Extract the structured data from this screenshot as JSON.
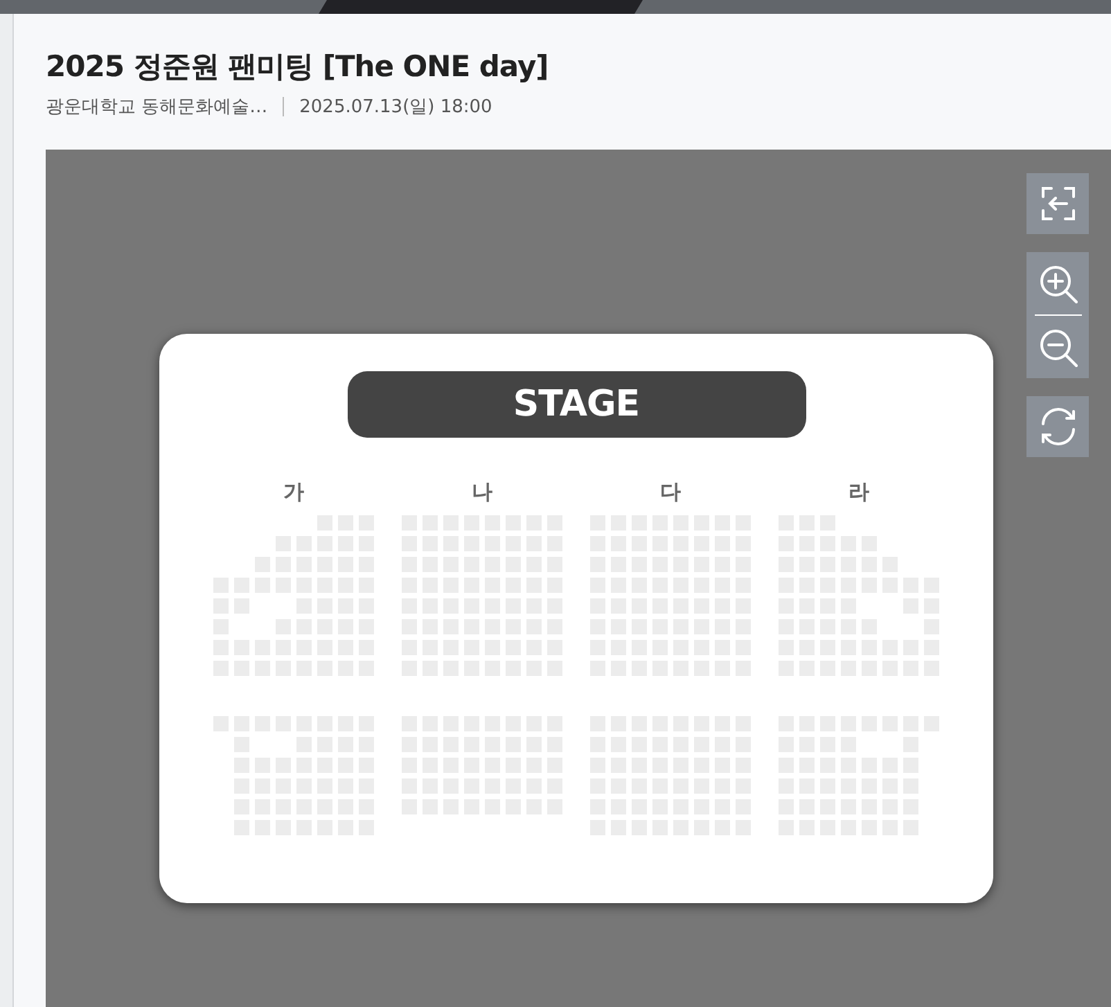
{
  "title": "2025 정준원 팬미팅 [The ONE day]",
  "venue": "광운대학교 동해문화예술…",
  "datetime": "2025.07.13(일) 18:00",
  "stage": "STAGE",
  "sections": [
    {
      "label": "가"
    },
    {
      "label": "나"
    },
    {
      "label": "다"
    },
    {
      "label": "라"
    }
  ]
}
